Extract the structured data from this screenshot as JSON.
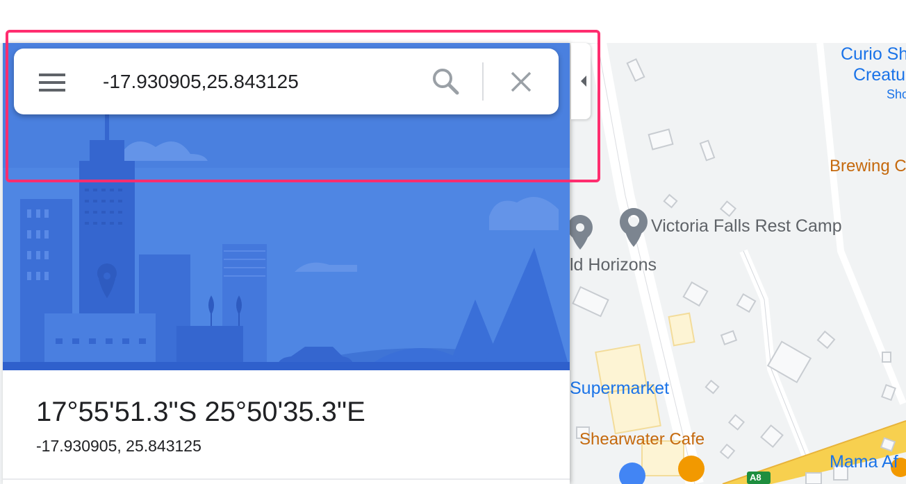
{
  "search": {
    "value": "-17.930905,25.843125",
    "menu_icon": "hamburger-menu-icon",
    "search_icon": "magnifier-icon",
    "close_icon": "close-x-icon"
  },
  "place": {
    "dms": "17°55'51.3\"S 25°50'35.3\"E",
    "decimal": "-17.930905, 25.843125"
  },
  "map": {
    "labels": {
      "curio_line1": "Curio Sh",
      "curio_line2": "Creatu",
      "curio_line3": "Sho",
      "brewing": "Brewing C",
      "rest_camp": "Victoria Falls Rest Camp",
      "horizons": "ld Horizons",
      "supermarket": "Supermarket",
      "shearwater": "Shearwater Cafe",
      "mama": "Mama Af",
      "road_badge": "A8"
    }
  },
  "colors": {
    "highlight": "#ff2d6f",
    "hero_sky": "#4f86e3",
    "map_background": "#f1f3f4",
    "road_yellow": "#f7d04f",
    "label_blue": "#1a73e8",
    "label_orange": "#c5690d"
  }
}
